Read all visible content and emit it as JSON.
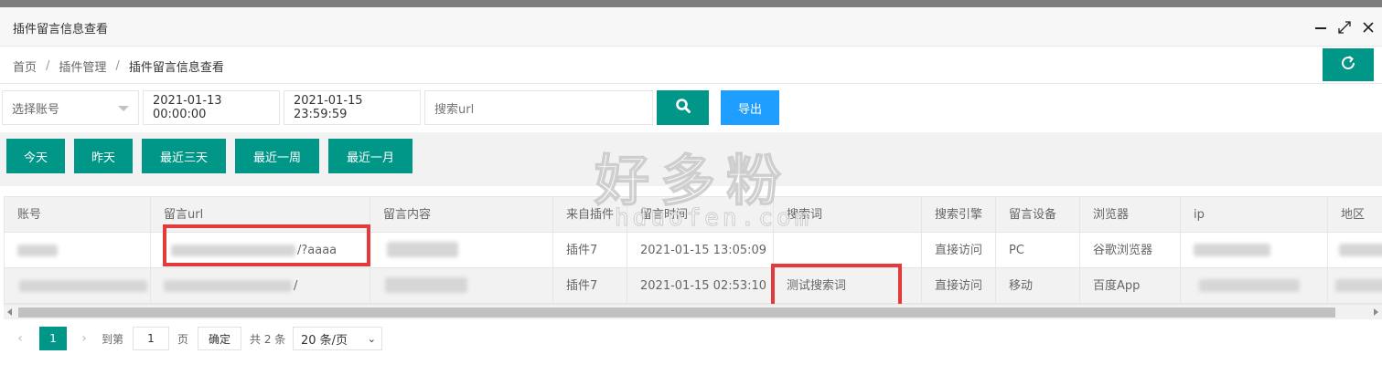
{
  "window": {
    "title": "插件留言信息查看"
  },
  "breadcrumb": [
    "首页",
    "插件管理",
    "插件留言信息查看"
  ],
  "filters": {
    "account_select": "选择账号",
    "start_date": "2021-01-13 00:00:00",
    "end_date": "2021-01-15 23:59:59",
    "search_placeholder": "搜索url",
    "export_label": "导出"
  },
  "quick_ranges": [
    "今天",
    "昨天",
    "最近三天",
    "最近一周",
    "最近一月"
  ],
  "watermark": {
    "text": "好多粉",
    "url": "hduofen.com"
  },
  "table": {
    "columns": [
      "账号",
      "留言url",
      "留言内容",
      "来自插件",
      "留言时间",
      "搜索词",
      "搜索引擎",
      "留言设备",
      "浏览器",
      "ip",
      "地区"
    ],
    "rows": [
      {
        "url_suffix": "/?aaaa",
        "plugin": "插件7",
        "time": "2021-01-15 13:05:09",
        "search_term": "",
        "engine": "直接访问",
        "device": "PC",
        "browser": "谷歌浏览器"
      },
      {
        "url_suffix": "/",
        "plugin": "插件7",
        "time": "2021-01-15 02:53:10",
        "search_term": "测试搜索词",
        "engine": "直接访问",
        "device": "移动",
        "browser": "百度App"
      }
    ]
  },
  "pagination": {
    "current_page": "1",
    "goto_label": "到第",
    "goto_value": "1",
    "page_unit": "页",
    "confirm_label": "确定",
    "total_label": "共 2 条",
    "page_size": "20 条/页"
  },
  "colors": {
    "primary": "#009688",
    "export": "#1e9fff",
    "highlight": "#e33b3b"
  }
}
